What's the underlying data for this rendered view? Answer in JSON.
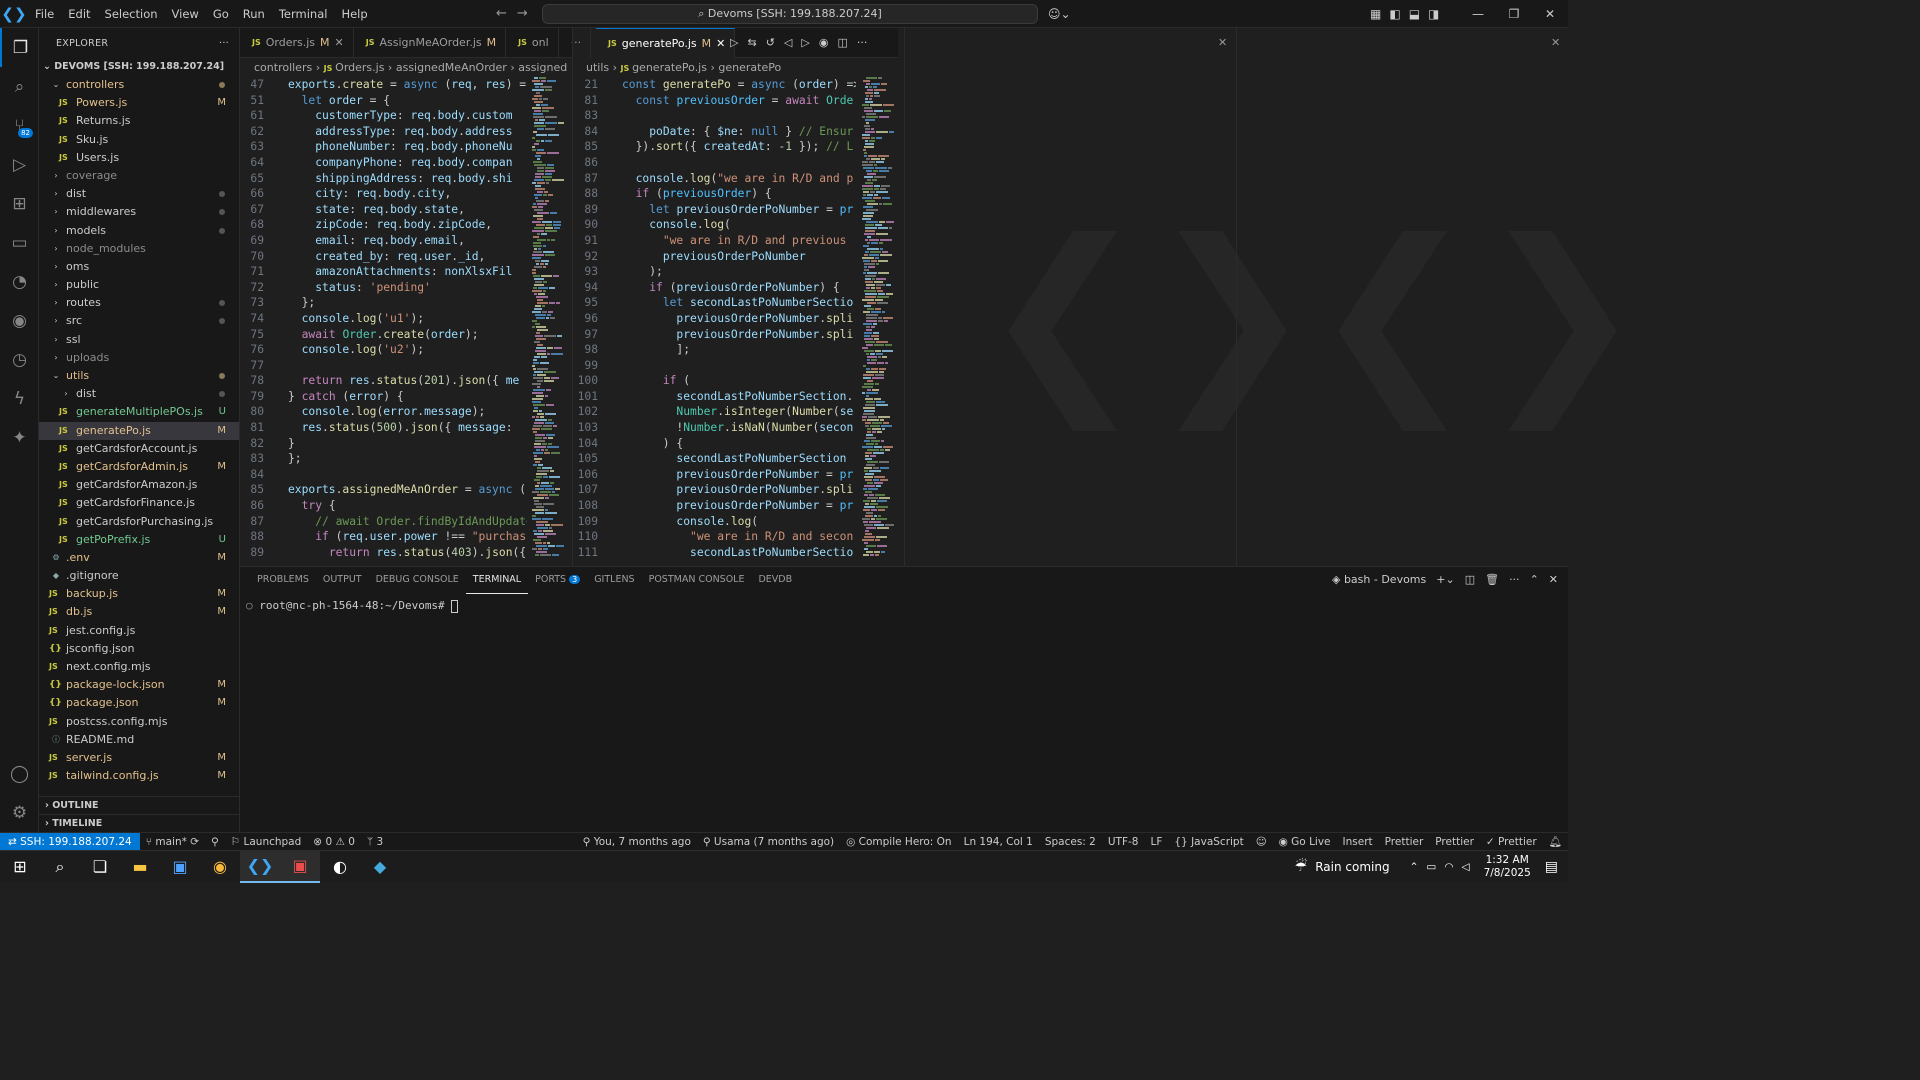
{
  "titlebar": {
    "menu": [
      "File",
      "Edit",
      "Selection",
      "View",
      "Go",
      "Run",
      "Terminal",
      "Help"
    ],
    "search_text": "Devoms [SSH: 199.188.207.24]"
  },
  "sidebar": {
    "title": "EXPLORER",
    "root": "DEVOMS [SSH: 199.188.207.24]",
    "items": [
      {
        "label": "controllers",
        "kind": "folder-open",
        "indent": 1,
        "color": "#e2c08d",
        "status": "dot"
      },
      {
        "label": "Powers.js",
        "kind": "js",
        "indent": 2,
        "color": "#e2c08d",
        "status": "M"
      },
      {
        "label": "Returns.js",
        "kind": "js",
        "indent": 2,
        "color": "#ccc",
        "status": ""
      },
      {
        "label": "Sku.js",
        "kind": "js",
        "indent": 2,
        "color": "#ccc",
        "status": ""
      },
      {
        "label": "Users.js",
        "kind": "js",
        "indent": 2,
        "color": "#ccc",
        "status": ""
      },
      {
        "label": "coverage",
        "kind": "folder",
        "indent": 1,
        "color": "#8c8c8c",
        "status": ""
      },
      {
        "label": "dist",
        "kind": "folder",
        "indent": 1,
        "color": "#ccc",
        "status": "dot"
      },
      {
        "label": "middlewares",
        "kind": "folder",
        "indent": 1,
        "color": "#ccc",
        "status": "dot"
      },
      {
        "label": "models",
        "kind": "folder",
        "indent": 1,
        "color": "#ccc",
        "status": "dot"
      },
      {
        "label": "node_modules",
        "kind": "folder",
        "indent": 1,
        "color": "#8c8c8c",
        "status": ""
      },
      {
        "label": "oms",
        "kind": "folder",
        "indent": 1,
        "color": "#ccc",
        "status": ""
      },
      {
        "label": "public",
        "kind": "folder",
        "indent": 1,
        "color": "#ccc",
        "status": ""
      },
      {
        "label": "routes",
        "kind": "folder",
        "indent": 1,
        "color": "#ccc",
        "status": "dot"
      },
      {
        "label": "src",
        "kind": "folder",
        "indent": 1,
        "color": "#ccc",
        "status": "dot"
      },
      {
        "label": "ssl",
        "kind": "folder",
        "indent": 1,
        "color": "#ccc",
        "status": ""
      },
      {
        "label": "uploads",
        "kind": "folder",
        "indent": 1,
        "color": "#8c8c8c",
        "status": ""
      },
      {
        "label": "utils",
        "kind": "folder-open",
        "indent": 1,
        "color": "#e2c08d",
        "status": "dot"
      },
      {
        "label": "dist",
        "kind": "folder",
        "indent": 2,
        "color": "#ccc",
        "status": "dot"
      },
      {
        "label": "generateMultiplePOs.js",
        "kind": "js",
        "indent": 2,
        "color": "#73c991",
        "status": "U"
      },
      {
        "label": "generatePo.js",
        "kind": "js",
        "indent": 2,
        "color": "#e2c08d",
        "status": "M",
        "selected": true
      },
      {
        "label": "getCardsforAccount.js",
        "kind": "js",
        "indent": 2,
        "color": "#ccc",
        "status": ""
      },
      {
        "label": "getCardsforAdmin.js",
        "kind": "js",
        "indent": 2,
        "color": "#e2c08d",
        "status": "M"
      },
      {
        "label": "getCardsforAmazon.js",
        "kind": "js",
        "indent": 2,
        "color": "#ccc",
        "status": ""
      },
      {
        "label": "getCardsforFinance.js",
        "kind": "js",
        "indent": 2,
        "color": "#ccc",
        "status": ""
      },
      {
        "label": "getCardsforPurchasing.js",
        "kind": "js",
        "indent": 2,
        "color": "#ccc",
        "status": ""
      },
      {
        "label": "getPoPrefix.js",
        "kind": "js",
        "indent": 2,
        "color": "#73c991",
        "status": "U"
      },
      {
        "label": ".env",
        "kind": "gear",
        "indent": 1,
        "color": "#e2c08d",
        "status": "M"
      },
      {
        "label": ".gitignore",
        "kind": "git",
        "indent": 1,
        "color": "#ccc",
        "status": ""
      },
      {
        "label": "backup.js",
        "kind": "js",
        "indent": 1,
        "color": "#e2c08d",
        "status": "M"
      },
      {
        "label": "db.js",
        "kind": "js",
        "indent": 1,
        "color": "#e2c08d",
        "status": "M"
      },
      {
        "label": "jest.config.js",
        "kind": "js",
        "indent": 1,
        "color": "#ccc",
        "status": ""
      },
      {
        "label": "jsconfig.json",
        "kind": "json",
        "indent": 1,
        "color": "#ccc",
        "status": ""
      },
      {
        "label": "next.config.mjs",
        "kind": "js",
        "indent": 1,
        "color": "#ccc",
        "status": ""
      },
      {
        "label": "package-lock.json",
        "kind": "json",
        "indent": 1,
        "color": "#e2c08d",
        "status": "M"
      },
      {
        "label": "package.json",
        "kind": "json",
        "indent": 1,
        "color": "#e2c08d",
        "status": "M"
      },
      {
        "label": "postcss.config.mjs",
        "kind": "js",
        "indent": 1,
        "color": "#ccc",
        "status": ""
      },
      {
        "label": "README.md",
        "kind": "info",
        "indent": 1,
        "color": "#ccc",
        "status": ""
      },
      {
        "label": "server.js",
        "kind": "js",
        "indent": 1,
        "color": "#e2c08d",
        "status": "M"
      },
      {
        "label": "tailwind.config.js",
        "kind": "js",
        "indent": 1,
        "color": "#e2c08d",
        "status": "M"
      }
    ],
    "outline": "OUTLINE",
    "timeline": "TIMELINE"
  },
  "editor_left": {
    "tabs": [
      {
        "label": "Orders.js",
        "flag": "M",
        "active": false
      },
      {
        "label": "AssignMeAOrder.js",
        "flag": "M",
        "active": false
      },
      {
        "label": "onl",
        "flag": "",
        "active": false
      }
    ],
    "breadcrumb": [
      "controllers",
      "Orders.js",
      "assignedMeAnOrder",
      "assigned"
    ],
    "lines": [
      {
        "n": "47",
        "h": "<span class='var'>exports</span>.<span class='fn'>create</span> = <span class='kw'>async</span> (<span class='var'>req</span>, <span class='var'>res</span>) ="
      },
      {
        "n": "51",
        "h": "  <span class='kw'>let</span> <span class='var'>order</span> = {"
      },
      {
        "n": "61",
        "h": "    <span class='var'>customerType</span>: <span class='var'>req</span>.<span class='var'>body</span>.<span class='var'>custom</span>"
      },
      {
        "n": "62",
        "h": "    <span class='var'>addressType</span>: <span class='var'>req</span>.<span class='var'>body</span>.<span class='var'>address</span>"
      },
      {
        "n": "63",
        "h": "    <span class='var'>phoneNumber</span>: <span class='var'>req</span>.<span class='var'>body</span>.<span class='var'>phoneNu</span>"
      },
      {
        "n": "64",
        "h": "    <span class='var'>companyPhone</span>: <span class='var'>req</span>.<span class='var'>body</span>.<span class='var'>compan</span>"
      },
      {
        "n": "65",
        "h": "    <span class='var'>shippingAddress</span>: <span class='var'>req</span>.<span class='var'>body</span>.<span class='var'>shi</span>"
      },
      {
        "n": "66",
        "h": "    <span class='var'>city</span>: <span class='var'>req</span>.<span class='var'>body</span>.<span class='var'>city</span>,"
      },
      {
        "n": "67",
        "h": "    <span class='var'>state</span>: <span class='var'>req</span>.<span class='var'>body</span>.<span class='var'>state</span>,"
      },
      {
        "n": "68",
        "h": "    <span class='var'>zipCode</span>: <span class='var'>req</span>.<span class='var'>body</span>.<span class='var'>zipCode</span>,"
      },
      {
        "n": "69",
        "h": "    <span class='var'>email</span>: <span class='var'>req</span>.<span class='var'>body</span>.<span class='var'>email</span>,"
      },
      {
        "n": "70",
        "h": "    <span class='var'>created_by</span>: <span class='var'>req</span>.<span class='var'>user</span>.<span class='var'>_id</span>,"
      },
      {
        "n": "71",
        "h": "    <span class='var'>amazonAttachments</span>: <span class='var'>nonXlsxFil</span>"
      },
      {
        "n": "72",
        "h": "    <span class='var'>status</span>: <span class='str'>'pending'</span>"
      },
      {
        "n": "73",
        "h": "  };"
      },
      {
        "n": "74",
        "h": "  <span class='var'>console</span>.<span class='fn'>log</span>(<span class='str'>'u1'</span>);"
      },
      {
        "n": "75",
        "h": "  <span class='ctl'>await</span> <span class='cls'>Order</span>.<span class='fn'>create</span>(<span class='var'>order</span>);"
      },
      {
        "n": "76",
        "h": "  <span class='var'>console</span>.<span class='fn'>log</span>(<span class='str'>'u2'</span>);"
      },
      {
        "n": "77",
        "h": ""
      },
      {
        "n": "78",
        "h": "  <span class='ctl'>return</span> <span class='var'>res</span>.<span class='fn'>status</span>(<span class='num'>201</span>).<span class='fn'>json</span>({ <span class='var'>me</span>"
      },
      {
        "n": "79",
        "h": "} <span class='ctl'>catch</span> (<span class='var'>error</span>) {"
      },
      {
        "n": "80",
        "h": "  <span class='var'>console</span>.<span class='fn'>log</span>(<span class='var'>error</span>.<span class='var'>message</span>);"
      },
      {
        "n": "81",
        "h": "  <span class='var'>res</span>.<span class='fn'>status</span>(<span class='num'>500</span>).<span class='fn'>json</span>({ <span class='var'>message</span>:"
      },
      {
        "n": "82",
        "h": "}"
      },
      {
        "n": "83",
        "h": "};"
      },
      {
        "n": "84",
        "h": ""
      },
      {
        "n": "85",
        "h": "<span class='var'>exports</span>.<span class='fn'>assignedMeAnOrder</span> = <span class='kw'>async</span> ("
      },
      {
        "n": "86",
        "h": "  <span class='ctl'>try</span> {"
      },
      {
        "n": "87",
        "h": "    <span class='cm'>// await Order.findByIdAndUpdate</span>"
      },
      {
        "n": "88",
        "h": "    <span class='ctl'>if</span> (<span class='var'>req</span>.<span class='var'>user</span>.<span class='var'>power</span> !== <span class='str'>\"purchas</span>"
      },
      {
        "n": "89",
        "h": "      <span class='ctl'>return</span> <span class='var'>res</span>.<span class='fn'>status</span>(<span class='num'>403</span>).<span class='fn'>json</span>({"
      }
    ]
  },
  "editor_right": {
    "tabs": [
      {
        "label": "generatePo.js",
        "flag": "M",
        "active": true
      }
    ],
    "breadcrumb": [
      "utils",
      "generatePo.js",
      "generatePo"
    ],
    "lines": [
      {
        "n": "21",
        "h": "<span class='kw'>const</span> <span class='fn'>generatePo</span> = <span class='kw'>async</span> (<span class='var'>order</span>) =>"
      },
      {
        "n": "81",
        "h": "  <span class='kw'>const</span> <span class='cst'>previousOrder</span> = <span class='ctl'>await</span> <span class='cls'>Orde</span>"
      },
      {
        "n": "83",
        "h": ""
      },
      {
        "n": "84",
        "h": "    <span class='var'>poDate</span>: { <span class='var'>$ne</span>: <span class='kw'>null</span> } <span class='cm'>// Ensur</span>"
      },
      {
        "n": "85",
        "h": "  }).<span class='fn'>sort</span>({ <span class='var'>createdAt</span>: <span class='num'>-1</span> }); <span class='cm'>// L</span>"
      },
      {
        "n": "86",
        "h": ""
      },
      {
        "n": "87",
        "h": "  <span class='var'>console</span>.<span class='fn'>log</span>(<span class='str'>\"we are in R/D and p</span>"
      },
      {
        "n": "88",
        "h": "  <span class='ctl'>if</span> (<span class='cst'>previousOrder</span>) {"
      },
      {
        "n": "89",
        "h": "    <span class='kw'>let</span> <span class='var'>previousOrderPoNumber</span> = <span class='cst'>pr</span>"
      },
      {
        "n": "90",
        "h": "    <span class='var'>console</span>.<span class='fn'>log</span>("
      },
      {
        "n": "91",
        "h": "      <span class='str'>\"we are in R/D and previous</span>"
      },
      {
        "n": "92",
        "h": "      <span class='var'>previousOrderPoNumber</span>"
      },
      {
        "n": "93",
        "h": "    );"
      },
      {
        "n": "94",
        "h": "    <span class='ctl'>if</span> (<span class='var'>previousOrderPoNumber</span>) {"
      },
      {
        "n": "95",
        "h": "      <span class='kw'>let</span> <span class='var'>secondLastPoNumberSectio</span>"
      },
      {
        "n": "96",
        "h": "        <span class='var'>previousOrderPoNumber</span>.<span class='fn'>spli</span>"
      },
      {
        "n": "97",
        "h": "        <span class='var'>previousOrderPoNumber</span>.<span class='fn'>spli</span>"
      },
      {
        "n": "98",
        "h": "        ];"
      },
      {
        "n": "99",
        "h": ""
      },
      {
        "n": "100",
        "h": "      <span class='ctl'>if</span> ("
      },
      {
        "n": "101",
        "h": "        <span class='var'>secondLastPoNumberSection</span>."
      },
      {
        "n": "102",
        "h": "        <span class='cls'>Number</span>.<span class='fn'>isInteger</span>(<span class='fn'>Number</span>(<span class='var'>se</span>"
      },
      {
        "n": "103",
        "h": "        !<span class='cls'>Number</span>.<span class='fn'>isNaN</span>(<span class='fn'>Number</span>(<span class='var'>secon</span>"
      },
      {
        "n": "104",
        "h": "      ) {"
      },
      {
        "n": "105",
        "h": "        <span class='var'>secondLastPoNumberSection</span>"
      },
      {
        "n": "106",
        "h": "        <span class='var'>previousOrderPoNumber</span> = <span class='cst'>pr</span>"
      },
      {
        "n": "107",
        "h": "        <span class='var'>previousOrderPoNumber</span>.<span class='fn'>spli</span>"
      },
      {
        "n": "108",
        "h": "        <span class='var'>previousOrderPoNumber</span> = <span class='cst'>pr</span>"
      },
      {
        "n": "109",
        "h": "        <span class='var'>console</span>.<span class='fn'>log</span>("
      },
      {
        "n": "110",
        "h": "          <span class='str'>\"we are in R/D and secon</span>"
      },
      {
        "n": "111",
        "h": "          <span class='var'>secondLastPoNumberSectio</span>"
      }
    ]
  },
  "panel": {
    "tabs": [
      "PROBLEMS",
      "OUTPUT",
      "DEBUG CONSOLE",
      "TERMINAL",
      "PORTS",
      "GITLENS",
      "POSTMAN CONSOLE",
      "DEVDB"
    ],
    "ports_badge": "3",
    "terminal_name": "bash - Devoms",
    "prompt": "root@nc-ph-1564-48:~/Devoms#"
  },
  "statusbar": {
    "remote": "SSH: 199.188.207.24",
    "branch": "main*",
    "launchpad": "Launchpad",
    "errors": "0",
    "warnings": "0",
    "ports": "3",
    "blame": "You, 7 months ago",
    "author": "Usama (7 months ago)",
    "compile_hero": "Compile Hero: On",
    "position": "Ln 194, Col 1",
    "spaces": "Spaces: 2",
    "encoding": "UTF-8",
    "eol": "LF",
    "language": "JavaScript",
    "golive": "Go Live",
    "insert": "Insert",
    "prettier1": "Prettier",
    "prettier2": "Prettier",
    "prettier3": "Prettier"
  },
  "taskbar": {
    "weather": "Rain coming",
    "time": "1:32 AM",
    "date": "7/8/2025"
  }
}
